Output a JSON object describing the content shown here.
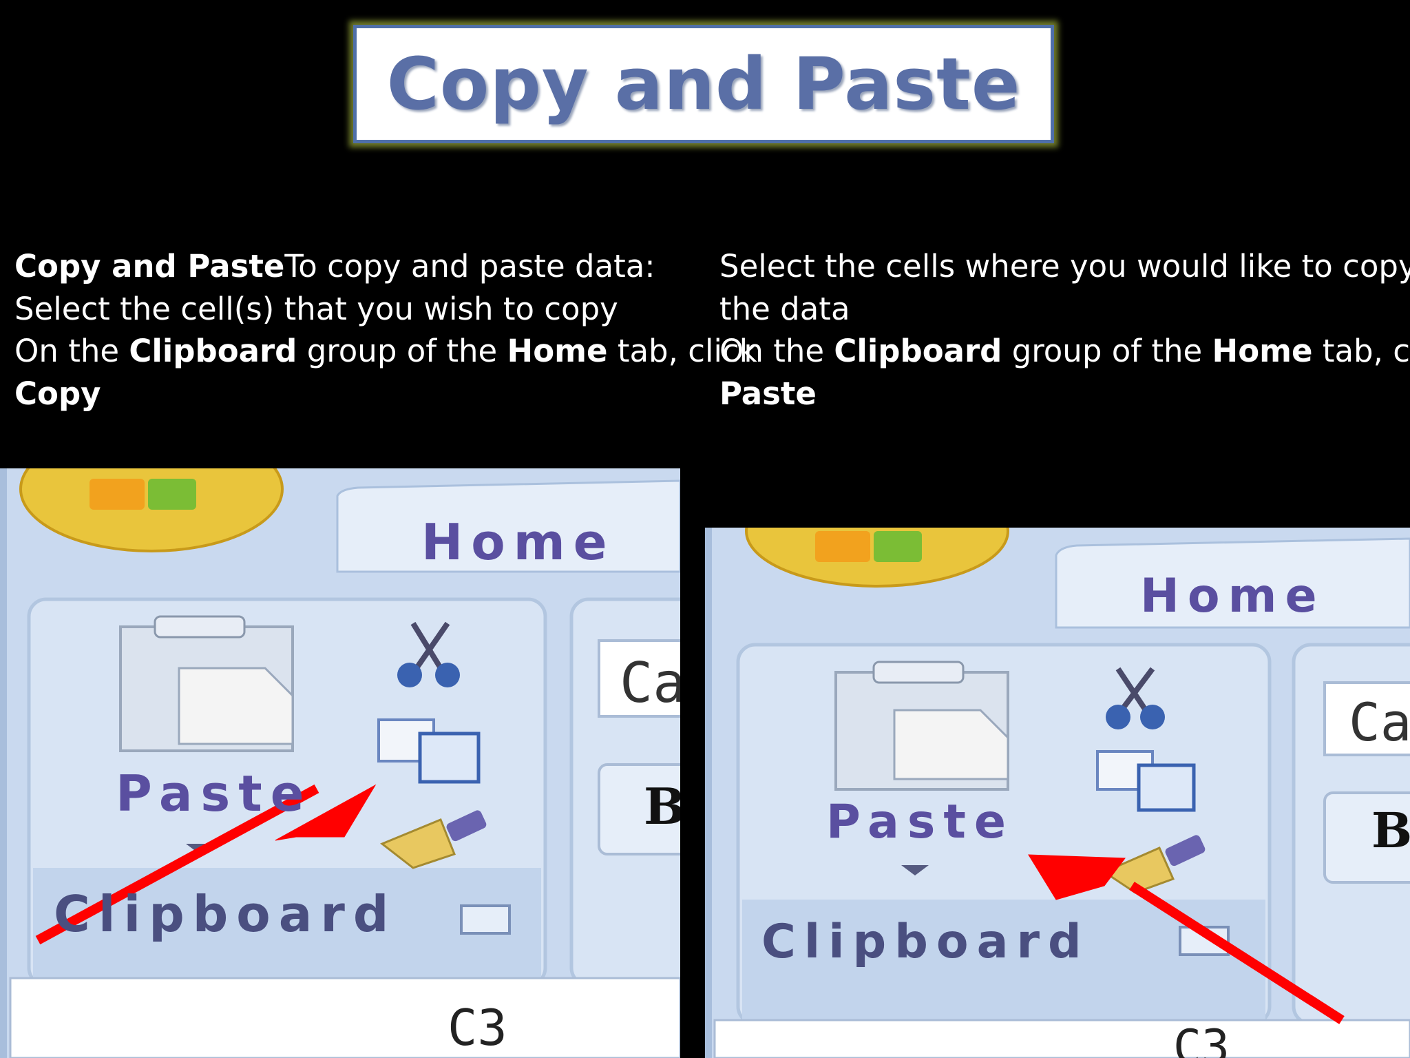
{
  "title": "Copy and Paste",
  "left_instructions": {
    "line1_bold": "Copy and Paste",
    "line1_rest": "To copy and paste data:",
    "line2": "Select the cell(s) that you wish to copy",
    "line3_a": "On the ",
    "line3_b": "Clipboard",
    "line3_c": " group of the ",
    "line3_d": "Home",
    "line3_e": " tab, click",
    "line4_bold": "Copy"
  },
  "right_instructions": {
    "line1": "Select the cells where you would like to copy",
    "line2": "the data",
    "line3_a": "On the ",
    "line3_b": "Clipboard",
    "line3_c": " group of the ",
    "line3_d": "Home",
    "line3_e": " tab, click",
    "line4_bold": "Paste"
  },
  "ribbon": {
    "tab_label": "Home",
    "paste_label": "Paste",
    "group_label": "Clipboard",
    "cell_ref": "C3",
    "truncated_font_label": "Ca",
    "truncated_bold_label": "B"
  },
  "colors": {
    "background": "#000000",
    "title_text": "#5a6fa6",
    "ribbon_bg": "#c9d9ef",
    "label_purple": "#5a4fa0",
    "arrow_red": "#ff0000"
  }
}
